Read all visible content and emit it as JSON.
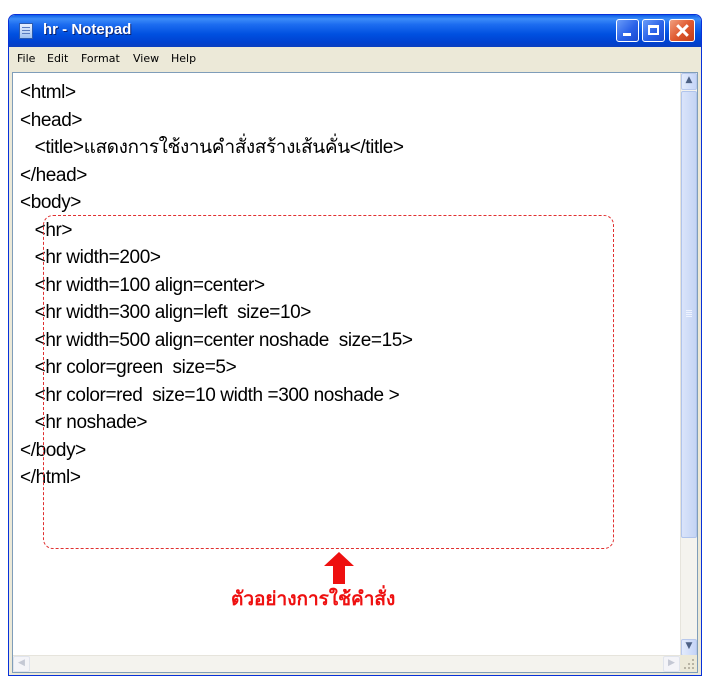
{
  "window": {
    "title": "hr - Notepad",
    "titlebar_color": "#0054e3",
    "close_button_color": "#e05a30"
  },
  "menu": {
    "items": [
      {
        "label": "File"
      },
      {
        "label": "Edit"
      },
      {
        "label": "Format"
      },
      {
        "label": "View"
      },
      {
        "label": "Help"
      }
    ]
  },
  "editor": {
    "lines": [
      "<html>",
      "<head>",
      "   <title>แสดงการใช้งานคำสั่งสร้างเส้นคั่น</title>",
      "</head>",
      "<body>",
      "   <hr>",
      "   <hr width=200>",
      "   <hr width=100 align=center>",
      "   <hr width=300 align=left  size=10>",
      "   <hr width=500 align=center noshade  size=15>",
      "   <hr color=green  size=5>",
      "   <hr color=red  size=10 width =300 noshade >",
      "   <hr noshade>",
      "</body>",
      "</html>"
    ]
  },
  "annotation": {
    "text": "ตัวอย่างการใช้คำสั่ง",
    "color": "#ee1010"
  },
  "icons": {
    "app": "notepad-icon",
    "minimize": "minimize-icon",
    "maximize": "maximize-icon",
    "close": "close-icon",
    "arrow": "arrow-up-icon"
  }
}
